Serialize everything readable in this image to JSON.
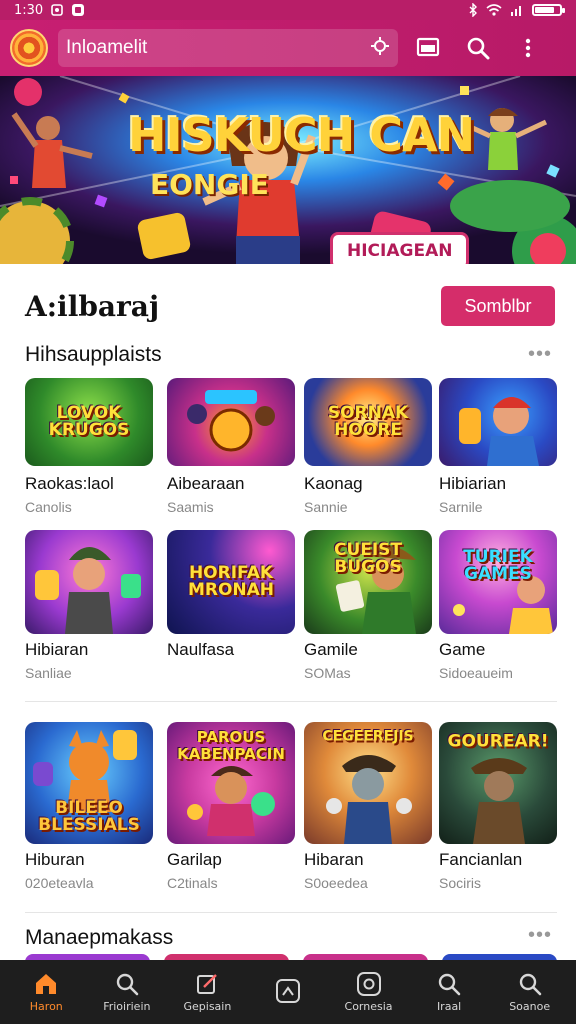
{
  "status_bar": {
    "time": "1:30",
    "icons": [
      "photo-icon",
      "message-icon",
      "bluetooth-icon",
      "wifi-icon",
      "signal-icon",
      "battery-icon"
    ],
    "battery_level": 0.8
  },
  "app_bar": {
    "search_placeholder": "Inloamelit",
    "icons": [
      "app-logo",
      "settings-icon",
      "cast-icon",
      "search-icon",
      "more-vert-icon"
    ],
    "accent_color": "#c81f72"
  },
  "banner": {
    "title": "HISKUCH CAN",
    "subtitle": "EONGIE",
    "badge": "HICIAGEAN"
  },
  "section": {
    "title": "A:ilbaraj",
    "action_label": "Somblbr"
  },
  "subsection_1": {
    "title": "Hihsaupplaists",
    "more": "•••"
  },
  "subsection_2": {
    "title": "Manaepmakass",
    "more": "•••"
  },
  "games": [
    {
      "title": "Raokas:laol",
      "subtitle": "Canolis",
      "thumb_text": "LOVOK KRUGOS"
    },
    {
      "title": "Aibearaan",
      "subtitle": "Saamis",
      "thumb_text": ""
    },
    {
      "title": "Kaonag",
      "subtitle": "Sannie",
      "thumb_text": "SORNAK HOORE"
    },
    {
      "title": "Hibiarian",
      "subtitle": "Sarnile",
      "thumb_text": ""
    },
    {
      "title": "Hibiaran",
      "subtitle": "Sanliae",
      "thumb_text": ""
    },
    {
      "title": "Naulfasa",
      "subtitle": "",
      "thumb_text": "HORIFAK MRONAH"
    },
    {
      "title": "Gamile",
      "subtitle": "SOMas",
      "thumb_text": "CUEIST BUGOS"
    },
    {
      "title": "Game",
      "subtitle": "Sidoeaueim",
      "thumb_text": "TURIEK GAMES"
    },
    {
      "title": "Hiburan",
      "subtitle": "020eteavla",
      "thumb_text": "BILEEO BLESSIALS"
    },
    {
      "title": "Garilap",
      "subtitle": "C2tinals",
      "thumb_text": "PAROUS KABENPACIN"
    },
    {
      "title": "Hibaran",
      "subtitle": "S0oeedea",
      "thumb_text": "CEGEEREJIS"
    },
    {
      "title": "Fancianlan",
      "subtitle": "Sociris",
      "thumb_text": "GOUREAR!"
    }
  ],
  "bottom_nav": [
    {
      "label": "Haron",
      "icon": "home-icon",
      "active": true
    },
    {
      "label": "Frioiriein",
      "icon": "search-icon",
      "active": false
    },
    {
      "label": "Gepisain",
      "icon": "edit-icon",
      "active": false
    },
    {
      "label": "",
      "icon": "app-square-icon",
      "active": false
    },
    {
      "label": "Cornesia",
      "icon": "target-icon",
      "active": false
    },
    {
      "label": "Iraal",
      "icon": "search-icon",
      "active": false
    },
    {
      "label": "Soanoe",
      "icon": "search-icon",
      "active": false
    }
  ]
}
